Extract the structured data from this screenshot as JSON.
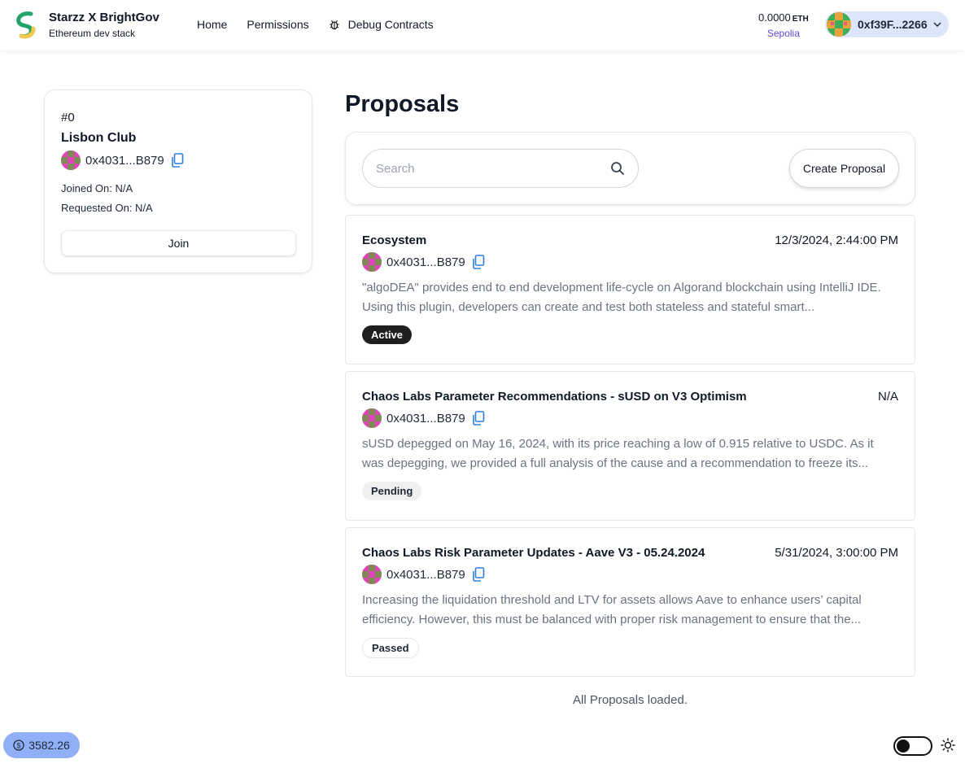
{
  "header": {
    "app_title": "Starzz X BrightGov",
    "app_subtitle": "Ethereum dev stack",
    "nav": {
      "home": "Home",
      "permissions": "Permissions",
      "debug": "Debug Contracts"
    },
    "balance": "0.0000",
    "balance_unit": "ETH",
    "network": "Sepolia",
    "account": "0xf39F...2266"
  },
  "club": {
    "id": "#0",
    "name": "Lisbon Club",
    "address": "0x4031...B879",
    "joined": "Joined On: N/A",
    "requested": "Requested On: N/A",
    "join_label": "Join"
  },
  "proposals": {
    "title": "Proposals",
    "search_placeholder": "Search",
    "create_label": "Create Proposal",
    "items": [
      {
        "title": "Ecosystem",
        "date": "12/3/2024, 2:44:00 PM",
        "address": "0x4031...B879",
        "description": "\"algoDEA\" provides end to end development life-cycle on Algorand blockchain using IntelliJ IDE. Using this plugin, developers can create and test both stateless and stateful smart...",
        "status": "Active"
      },
      {
        "title": "Chaos Labs Parameter Recommendations - sUSD on V3 Optimism",
        "date": "N/A",
        "address": "0x4031...B879",
        "description": "sUSD depegged on May 16, 2024, with its price reaching a low of 0.915 relative to USDC. As it was depegging, we provided a full analysis of the cause and a recommendation to freeze its...",
        "status": "Pending"
      },
      {
        "title": "Chaos Labs Risk Parameter Updates - Aave V3 - 05.24.2024",
        "date": "5/31/2024, 3:00:00 PM",
        "address": "0x4031...B879",
        "description": "Increasing the liquidation threshold and LTV for assets allows Aave to enhance users’ capital efficiency. However, this must be balanced with proper risk management to ensure that the...",
        "status": "Passed"
      }
    ],
    "footer": "All Proposals loaded."
  },
  "footer": {
    "price": "3582.26"
  },
  "colors": {
    "network": "#5b4bd6",
    "price_pill": "#8fb0f7",
    "account_pill": "#dbe6fb",
    "badge_active": "#1f1f1f"
  }
}
